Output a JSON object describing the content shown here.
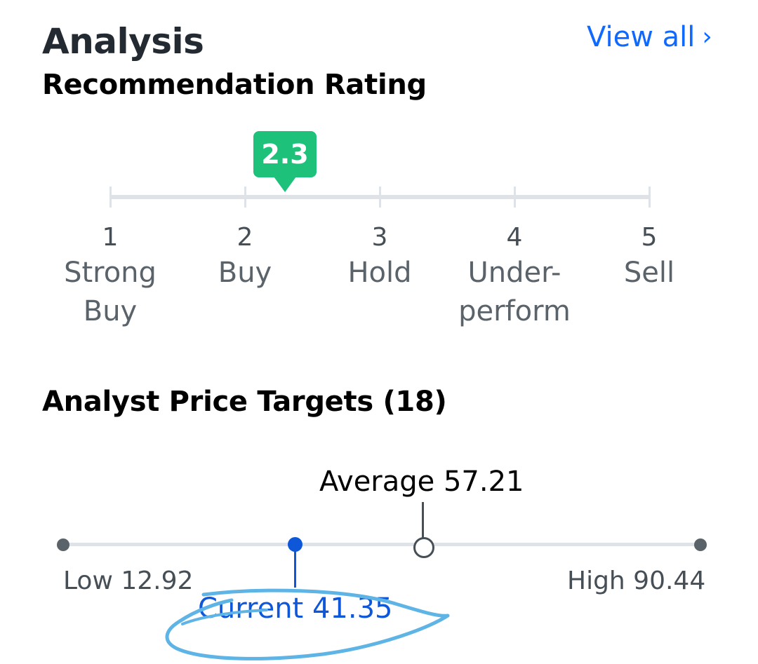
{
  "header": {
    "title": "Analysis",
    "view_all_label": "View all",
    "view_all_chevron": "›",
    "subtitle": "Recommendation Rating"
  },
  "rating": {
    "value": "2.3",
    "value_num": 2.3,
    "badge_color": "#1ec17a",
    "scale": [
      {
        "num": "1",
        "label": "Strong\nBuy"
      },
      {
        "num": "2",
        "label": "Buy"
      },
      {
        "num": "3",
        "label": "Hold"
      },
      {
        "num": "4",
        "label": "Under-\nperform"
      },
      {
        "num": "5",
        "label": "Sell"
      }
    ]
  },
  "price_targets": {
    "title": "Analyst Price Targets (18)",
    "average_label": "Average 57.21",
    "low_label": "Low 12.92",
    "high_label": "High 90.44",
    "current_label": "Current 41.35",
    "low": 12.92,
    "high": 90.44,
    "average": 57.21,
    "current": 41.35,
    "current_color": "#0f57d9"
  },
  "annotation": {
    "scribble_color": "#5fb4e6"
  }
}
